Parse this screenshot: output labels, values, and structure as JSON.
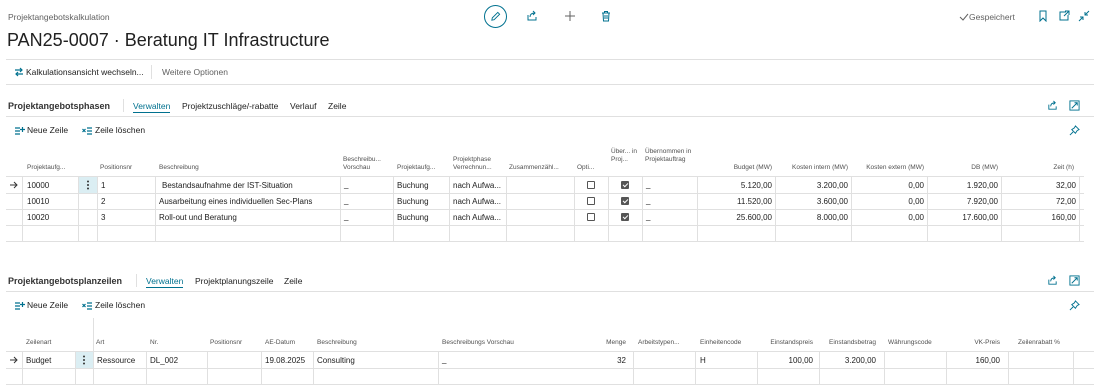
{
  "header": {
    "breadcrumb": "Projektangebotskalkulation",
    "title": "PAN25-0007 · Beratung IT Infrastructure",
    "saved_label": "Gespeichert"
  },
  "actionbar": {
    "switch_view": "Kalkulationsansicht wechseln...",
    "more_options": "Weitere Optionen"
  },
  "phases": {
    "title": "Projektangebotsphasen",
    "tabs": [
      "Verwalten",
      "Projektzuschläge/-rabatte",
      "Verlauf",
      "Zeile"
    ],
    "new_line": "Neue Zeile",
    "delete_line": "Zeile löschen",
    "columns": [
      "Projektaufg...",
      "Positionsnr",
      "Beschreibung",
      "Beschreibu... Vorschau",
      "Projektaufg...",
      "Projektphase Verrechnun...",
      "Zusammenzähl...",
      "Opti...",
      "Über... in Proj...",
      "Übernommen in Projektauftrag",
      "Budget (MW)",
      "Kosten intern (MW)",
      "Kosten extern (MW)",
      "DB (MW)",
      "Zeit (h)"
    ],
    "rows": [
      {
        "task": "10000",
        "pos": "1",
        "desc": "Bestandsaufnahme der IST-Situation",
        "preview": "_",
        "type": "Buchung",
        "billing": "nach Aufwa...",
        "opt": false,
        "transfer": true,
        "taken": "_",
        "budget": "5.120,00",
        "cost_int": "3.200,00",
        "cost_ext": "0,00",
        "db": "1.920,00",
        "time": "32,00"
      },
      {
        "task": "10010",
        "pos": "2",
        "desc": "Ausarbeitung eines individuellen Sec-Plans",
        "preview": "_",
        "type": "Buchung",
        "billing": "nach Aufwa...",
        "opt": false,
        "transfer": true,
        "taken": "_",
        "budget": "11.520,00",
        "cost_int": "3.600,00",
        "cost_ext": "0,00",
        "db": "7.920,00",
        "time": "72,00"
      },
      {
        "task": "10020",
        "pos": "3",
        "desc": "Roll-out und Beratung",
        "preview": "_",
        "type": "Buchung",
        "billing": "nach Aufwa...",
        "opt": false,
        "transfer": true,
        "taken": "_",
        "budget": "25.600,00",
        "cost_int": "8.000,00",
        "cost_ext": "0,00",
        "db": "17.600,00",
        "time": "160,00"
      }
    ]
  },
  "planlines": {
    "title": "Projektangebotsplanzeilen",
    "tabs": [
      "Verwalten",
      "Projektplanungszeile",
      "Zeile"
    ],
    "new_line": "Neue Zeile",
    "delete_line": "Zeile löschen",
    "columns": [
      "Zeilenart",
      "Art",
      "Nr.",
      "Positionsnr",
      "AE-Datum",
      "Beschreibung",
      "Beschreibungs Vorschau",
      "Menge",
      "Arbeitstypen...",
      "Einheitencode",
      "Einstandspreis",
      "Einstandsbetrag",
      "Währungscode",
      "VK-Preis",
      "Zeilenrabatt %"
    ],
    "rows": [
      {
        "linetype": "Budget",
        "kind": "Ressource",
        "no": "DL_002",
        "pos": "",
        "date": "19.08.2025",
        "desc": "Consulting",
        "preview": "_",
        "qty": "32",
        "worktype": "",
        "unit": "H",
        "unitcost": "100,00",
        "costamt": "3.200,00",
        "currency": "",
        "price": "160,00",
        "discount": ""
      }
    ]
  },
  "icons": [
    "edit-icon",
    "share-icon",
    "add-icon",
    "delete-icon",
    "checkmark-icon",
    "bookmark-icon",
    "open-new-icon",
    "collapse-icon",
    "switch-icon",
    "new-line-icon",
    "delete-line-icon",
    "pin-icon",
    "row-arrow-icon",
    "row-menu-icon"
  ],
  "colors": {
    "accent": "#00718f",
    "selected_row": "#dbeef3"
  }
}
